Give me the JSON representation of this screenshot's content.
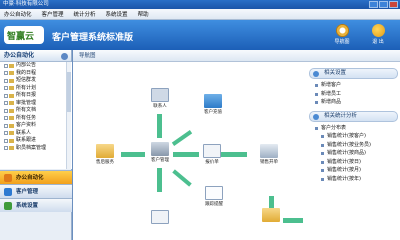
{
  "window": {
    "title": "中豪·科技有限公司"
  },
  "menu": [
    "办公自动化",
    "客户管理",
    "统计分析",
    "系统设置",
    "帮助"
  ],
  "banner": {
    "logo_text": "智赢云",
    "title": "客户管理系统标准版",
    "nav_button": "导航图",
    "quit_button": "退 出"
  },
  "sidebar": {
    "header": "办公自动化",
    "tree": [
      "内部公告",
      "我的日程",
      "短信群发",
      "所有计划",
      "所有日报",
      "审批管理",
      "所有文档",
      "所有任务",
      "客户资料",
      "联系人",
      "联系跟进",
      "职员档案管理"
    ],
    "modules": [
      {
        "label": "办公自动化",
        "active": true,
        "color": "#e07a18"
      },
      {
        "label": "客户管理",
        "active": false,
        "color": "#2e7ad1"
      },
      {
        "label": "系统设置",
        "active": false,
        "color": "#3f9b3a"
      }
    ]
  },
  "main": {
    "header": "导航图",
    "nodes": {
      "contact": "联系人",
      "recharge": "客户充值",
      "after_sales": "售后服务",
      "customer_mgmt": "客户管理",
      "quote": "报价单",
      "sales_order": "销售开单",
      "follow_up": "跟踪提醒"
    }
  },
  "right_panel": {
    "section1": {
      "title": "相关设置",
      "items": [
        "新增客户",
        "新增员工",
        "新增商品"
      ]
    },
    "section2": {
      "title": "相关统计分析",
      "items": [
        "客户分布表",
        "销售统计(按客户)",
        "销售统计(按业务员)",
        "销售统计(按商品)",
        "销售统计(按日)",
        "销售统计(按月)",
        "销售统计(按年)"
      ]
    }
  }
}
